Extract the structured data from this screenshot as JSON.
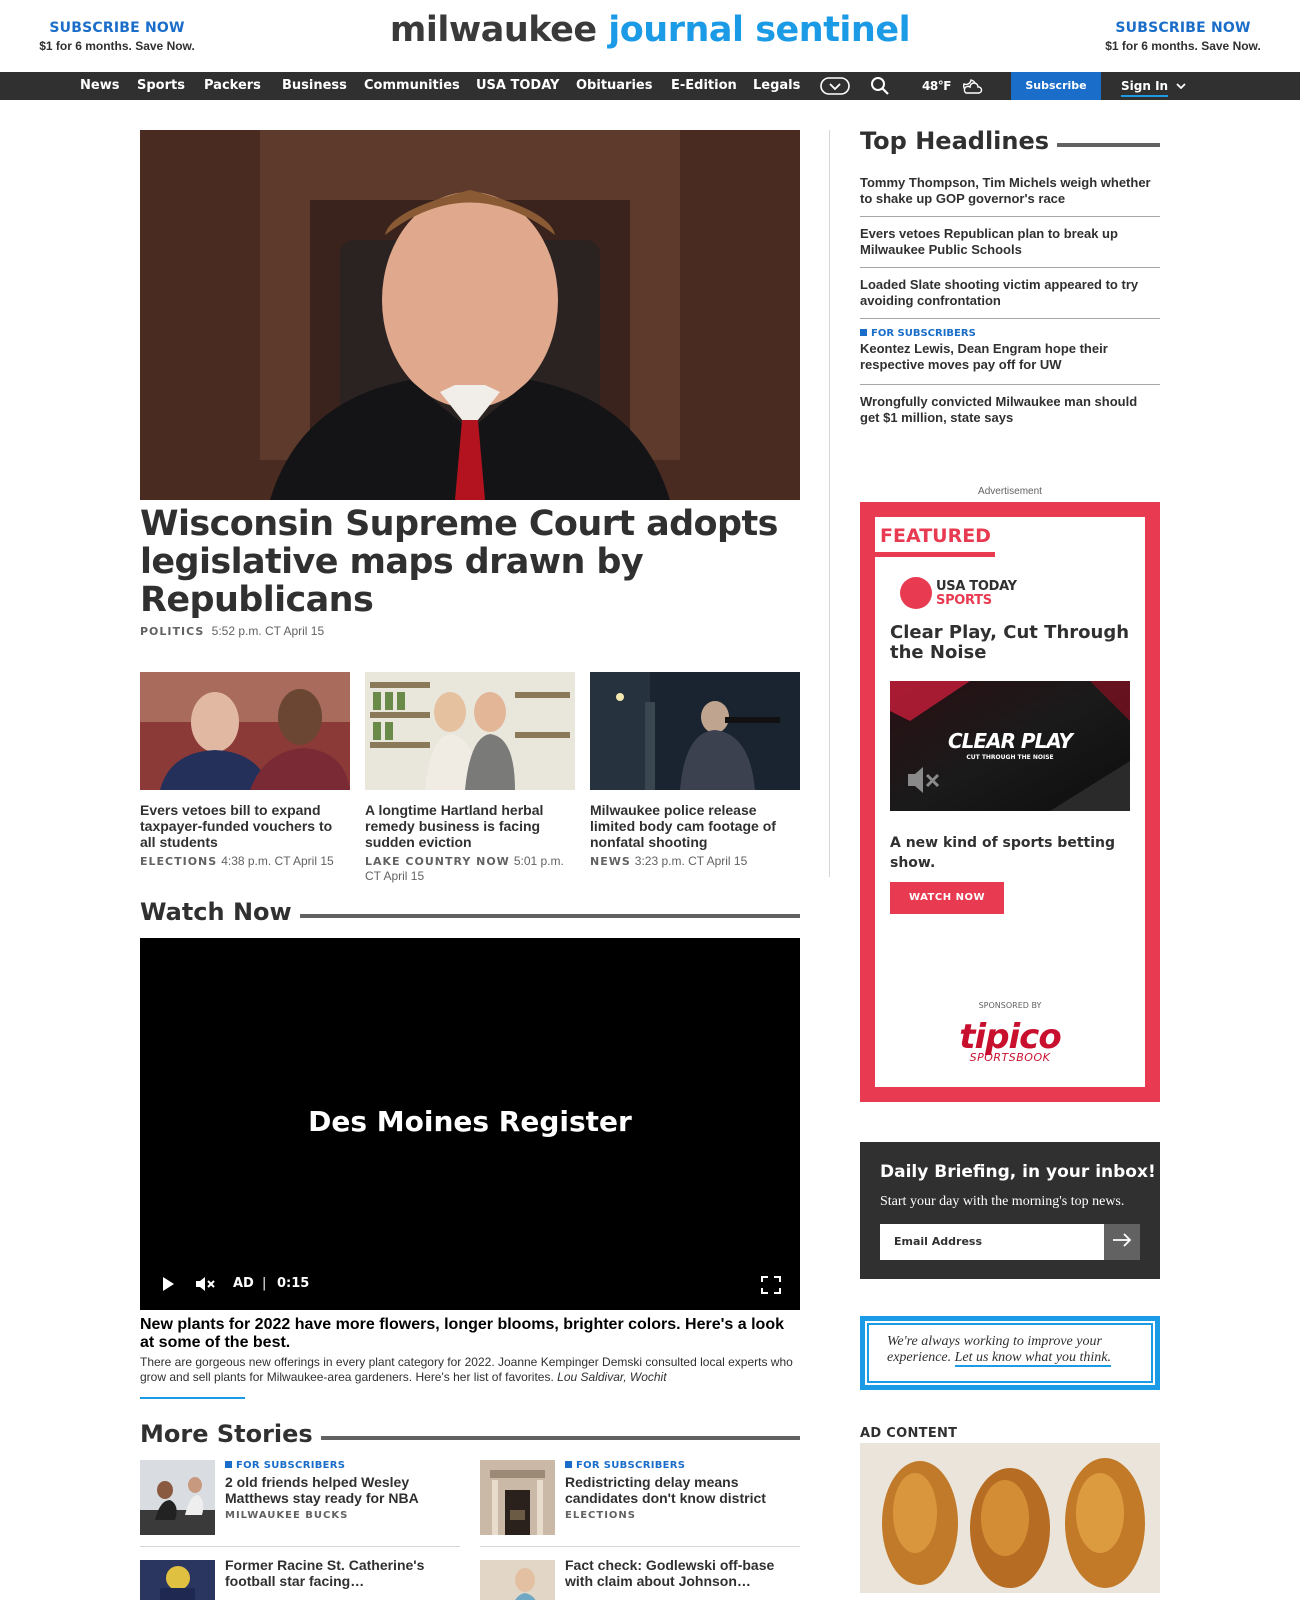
{
  "promo": {
    "left": {
      "cta": "SUBSCRIBE NOW",
      "sub": "$1 for 6 months. Save Now."
    },
    "right": {
      "cta": "SUBSCRIBE NOW",
      "sub": "$1 for 6 months. Save Now."
    }
  },
  "logo": {
    "part1": "milwaukee",
    "part2": "journal sentinel"
  },
  "nav": {
    "items": [
      "News",
      "Sports",
      "Packers",
      "Business",
      "Communities",
      "USA TODAY",
      "Obituaries",
      "E-Edition",
      "Legals"
    ],
    "weather": "48°F",
    "subscribe": "Subscribe",
    "signin": "Sign In"
  },
  "hero": {
    "title": "Wisconsin Supreme Court adopts legislative maps drawn by Republicans",
    "section": "POLITICS",
    "time": "5:52 p.m. CT April 15"
  },
  "cards": [
    {
      "title": "Evers vetoes bill to expand taxpayer-funded vouchers to all students",
      "section": "ELECTIONS",
      "time": "4:38 p.m. CT April 15"
    },
    {
      "title": "A longtime Hartland herbal remedy business is facing sudden eviction",
      "section": "LAKE COUNTRY NOW",
      "time": "5:01 p.m. CT April 15"
    },
    {
      "title": "Milwaukee police release limited body cam footage of nonfatal shooting",
      "section": "NEWS",
      "time": "3:23 p.m. CT April 15"
    }
  ],
  "watch": {
    "heading": "Watch Now",
    "brand": "Des Moines Register",
    "ad": "AD",
    "sep": "|",
    "time": "0:15",
    "title": "New plants for 2022 have more flowers, longer blooms, brighter colors. Here's a look at some of the best.",
    "desc": "There are gorgeous new offerings in every plant category for 2022. Joanne Kempinger Demski consulted local experts who grow and sell plants for Milwaukee-area gardeners. Here's her list of favorites.",
    "credit": "Lou Saldivar, Wochit"
  },
  "more": {
    "heading": "More Stories",
    "stories": [
      {
        "flag": "FOR SUBSCRIBERS",
        "title": "2 old friends helped Wesley Matthews stay ready for NBA",
        "label": "MILWAUKEE BUCKS"
      },
      {
        "flag": "FOR SUBSCRIBERS",
        "title": "Redistricting delay means candidates don't know district",
        "label": "ELECTIONS"
      },
      {
        "flag": "",
        "title": "Former Racine St. Catherine's football star facing…",
        "label": ""
      },
      {
        "flag": "",
        "title": "Fact check: Godlewski off-base with claim about Johnson…",
        "label": ""
      }
    ]
  },
  "top_headlines": {
    "heading": "Top Headlines",
    "items": [
      {
        "flag": "",
        "title": "Tommy Thompson, Tim Michels weigh whether to shake up GOP governor's race"
      },
      {
        "flag": "",
        "title": "Evers vetoes Republican plan to break up Milwaukee Public Schools"
      },
      {
        "flag": "",
        "title": "Loaded Slate shooting victim appeared to try avoiding confrontation"
      },
      {
        "flag": "FOR SUBSCRIBERS",
        "title": "Keontez Lewis, Dean Engram hope their respective moves pay off for UW"
      },
      {
        "flag": "",
        "title": "Wrongfully convicted Milwaukee man should get $1 million, state says"
      }
    ]
  },
  "featured": {
    "ad_label": "Advertisement",
    "heading": "FEATURED",
    "brand1": "USA TODAY",
    "brand2": "SPORTS",
    "title": "Clear Play, Cut Through the Noise",
    "video_title": "CLEAR PLAY",
    "video_sub": "CUT THROUGH THE NOISE",
    "desc": "A new kind of sports betting show.",
    "button": "WATCH NOW",
    "sponsored": "SPONSORED BY",
    "sponsor1": "tipico",
    "sponsor2": "SPORTSBOOK"
  },
  "daily": {
    "title": "Daily Briefing, in your inbox!",
    "sub": "Start your day with the morning's top news.",
    "placeholder": "Email Address"
  },
  "feedback": {
    "text": "We're always working to improve your experience.",
    "link": "Let us know what you think."
  },
  "adcontent": {
    "label": "AD CONTENT"
  },
  "colors": {
    "brand_blue": "#1a6dc8",
    "light_blue": "#1b9ae6",
    "nav_bg": "#303030",
    "featured_red": "#e83b52"
  }
}
